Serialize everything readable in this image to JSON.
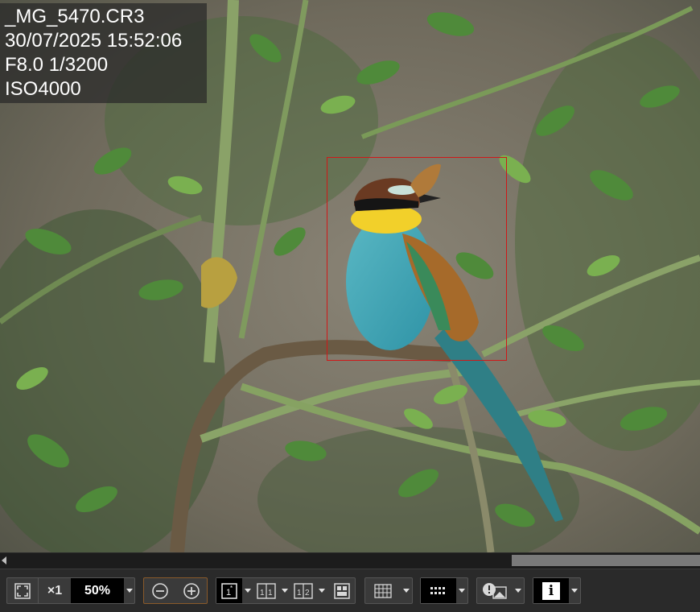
{
  "photo_info": {
    "filename": "_MG_5470.CR3",
    "datetime": "30/07/2025 15:52:06",
    "exposure": "F8.0 1/3200",
    "iso": "ISO4000"
  },
  "toolbar": {
    "fit_label": "",
    "zoom_1x_label": "×1",
    "zoom_value": "50%",
    "zoom_out_label": "−",
    "zoom_in_label": "+",
    "single_view_label": "1*",
    "dual_view_label": "1 1*",
    "compare_view_label": "1 2",
    "info_label": "i"
  },
  "colors": {
    "af_frame": "#d01818",
    "toolbar_bg": "#2a2a2a",
    "button_bg": "#3a3a3a"
  },
  "icons": [
    "fit-to-screen-icon",
    "zoom-out-icon",
    "zoom-in-icon",
    "single-view-icon",
    "dual-view-icon",
    "compare-view-icon",
    "split-view-icon",
    "grid-icon",
    "af-points-icon",
    "highlight-warning-icon",
    "info-icon"
  ]
}
